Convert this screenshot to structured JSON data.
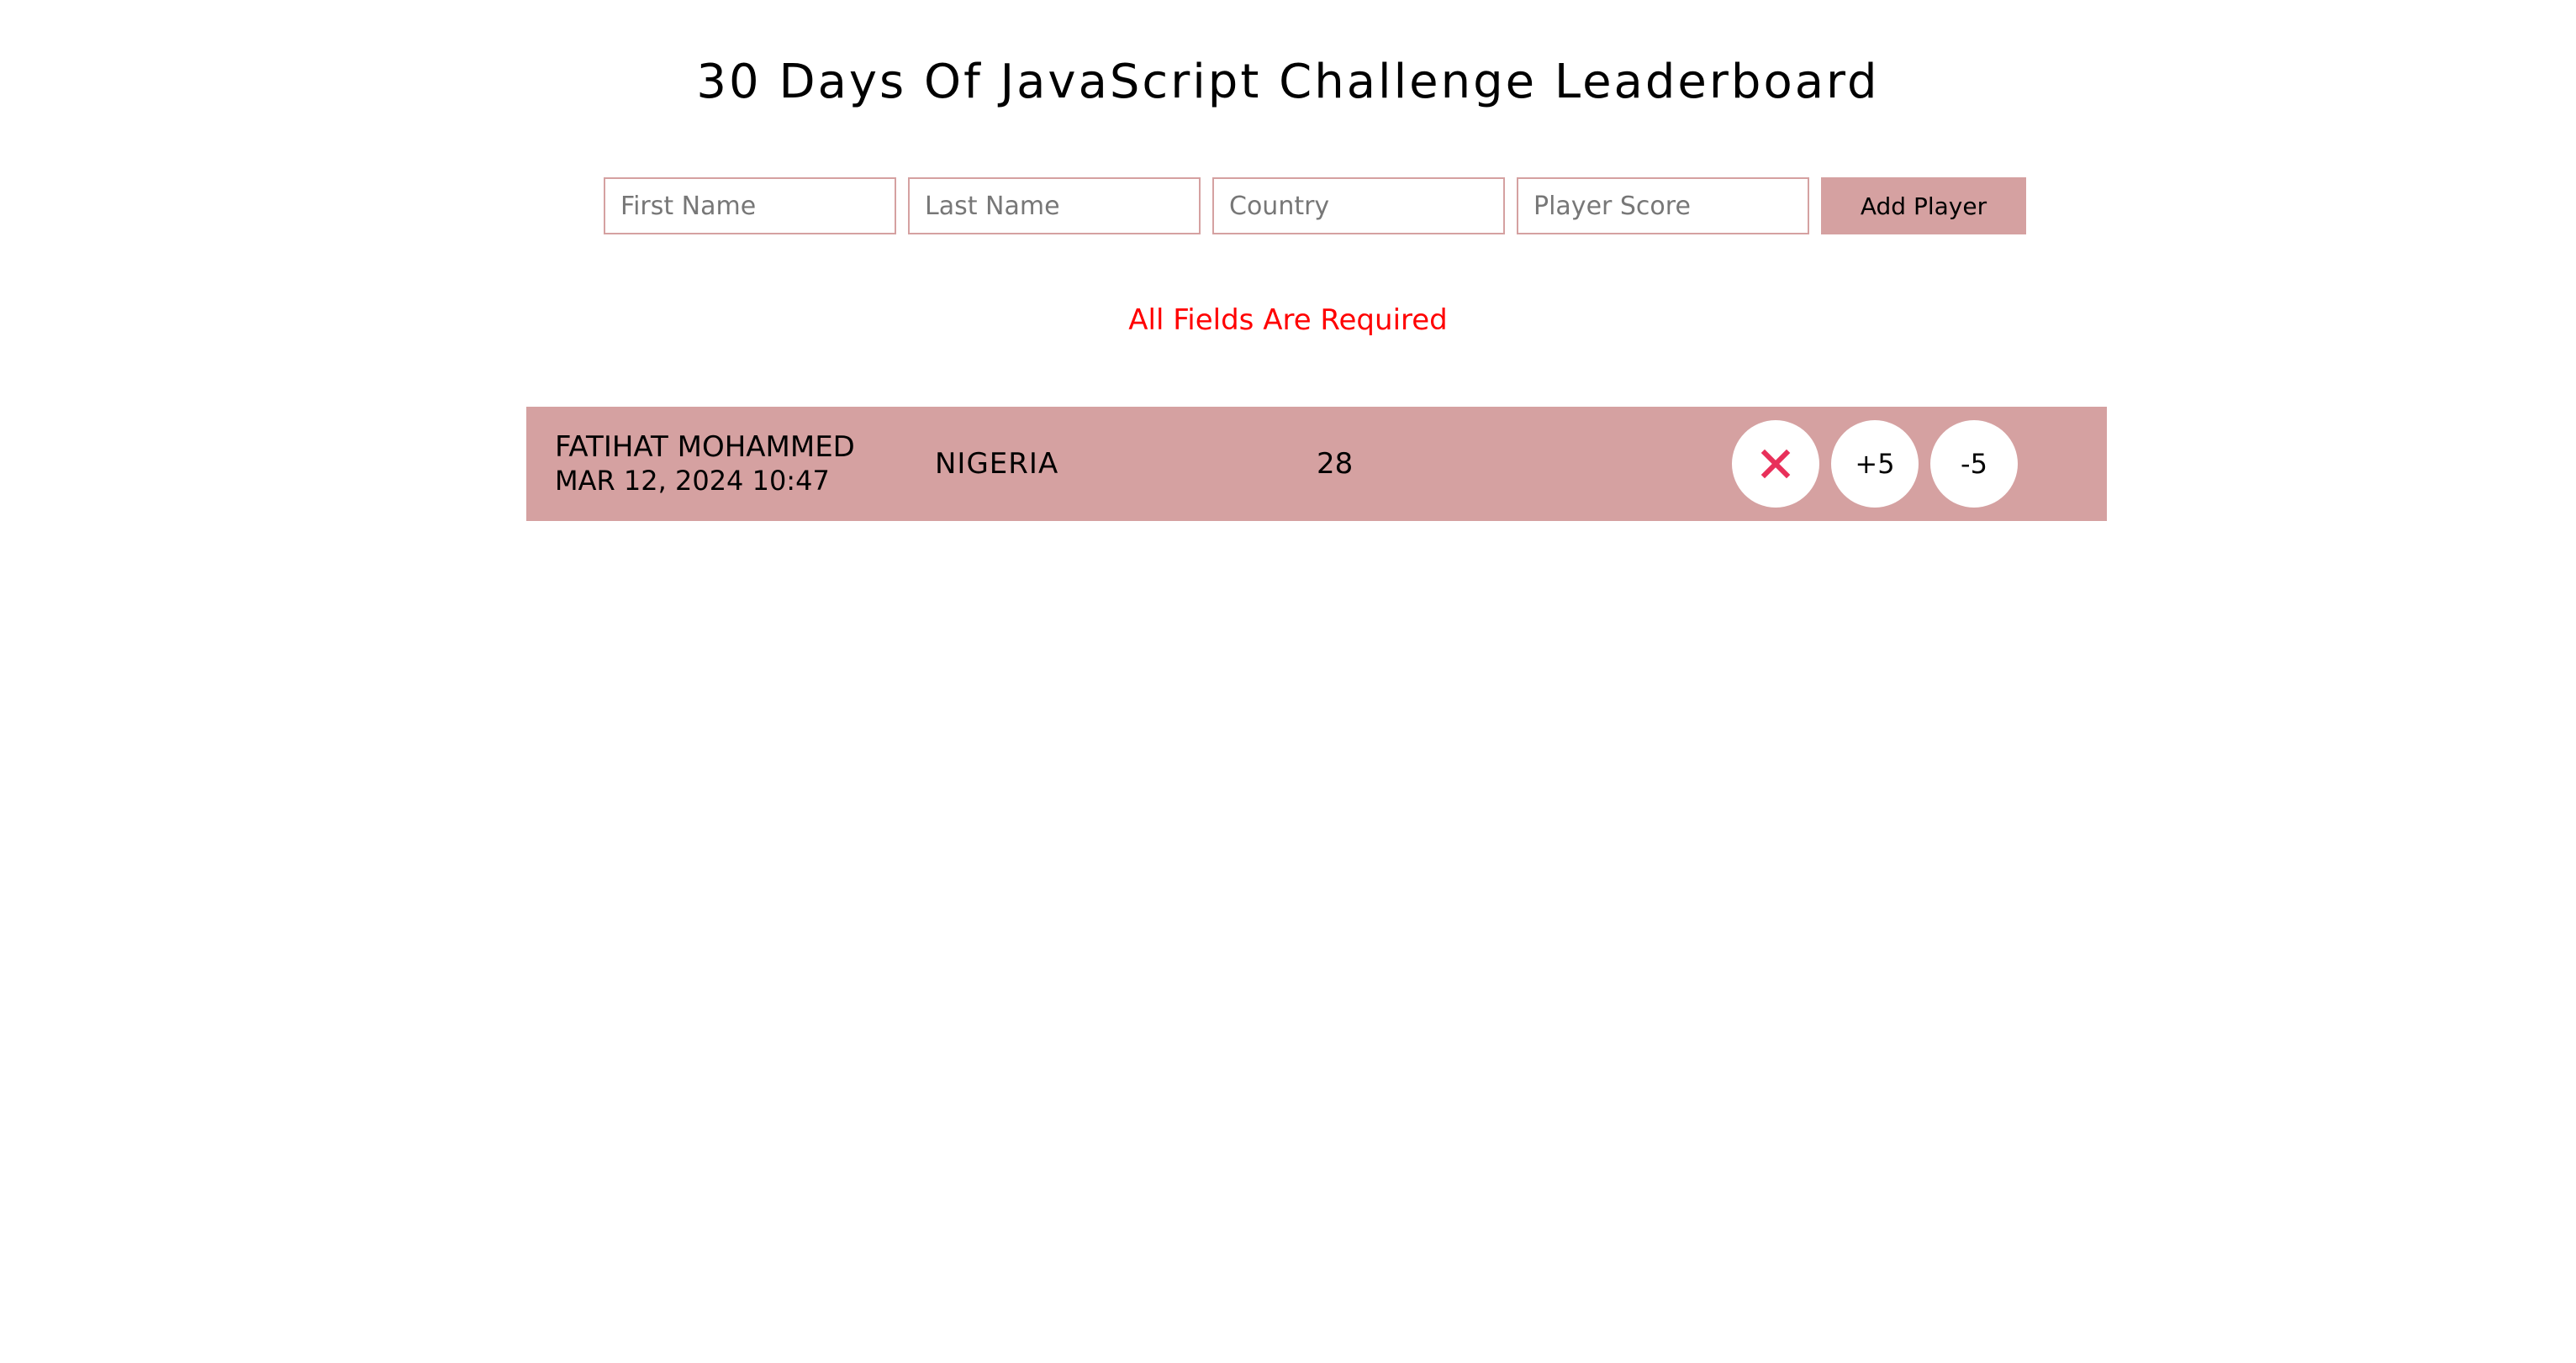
{
  "header": {
    "title": "30 Days Of JavaScript Challenge Leaderboard"
  },
  "form": {
    "first_name_placeholder": "First Name",
    "last_name_placeholder": "Last Name",
    "country_placeholder": "Country",
    "score_placeholder": "Player Score",
    "add_button_label": "Add Player"
  },
  "validation": {
    "message": "All Fields Are Required"
  },
  "leaderboard": {
    "players": [
      {
        "name": "FATIHAT MOHAMMED",
        "date": "MAR 12, 2024 10:47",
        "country": "NIGERIA",
        "score": "28",
        "delete_icon": "close-icon",
        "plus_label": "+5",
        "minus_label": "-5"
      }
    ]
  },
  "colors": {
    "accent": "#d5a1a1",
    "error": "#ff0000",
    "delete_icon": "#e8305a"
  }
}
